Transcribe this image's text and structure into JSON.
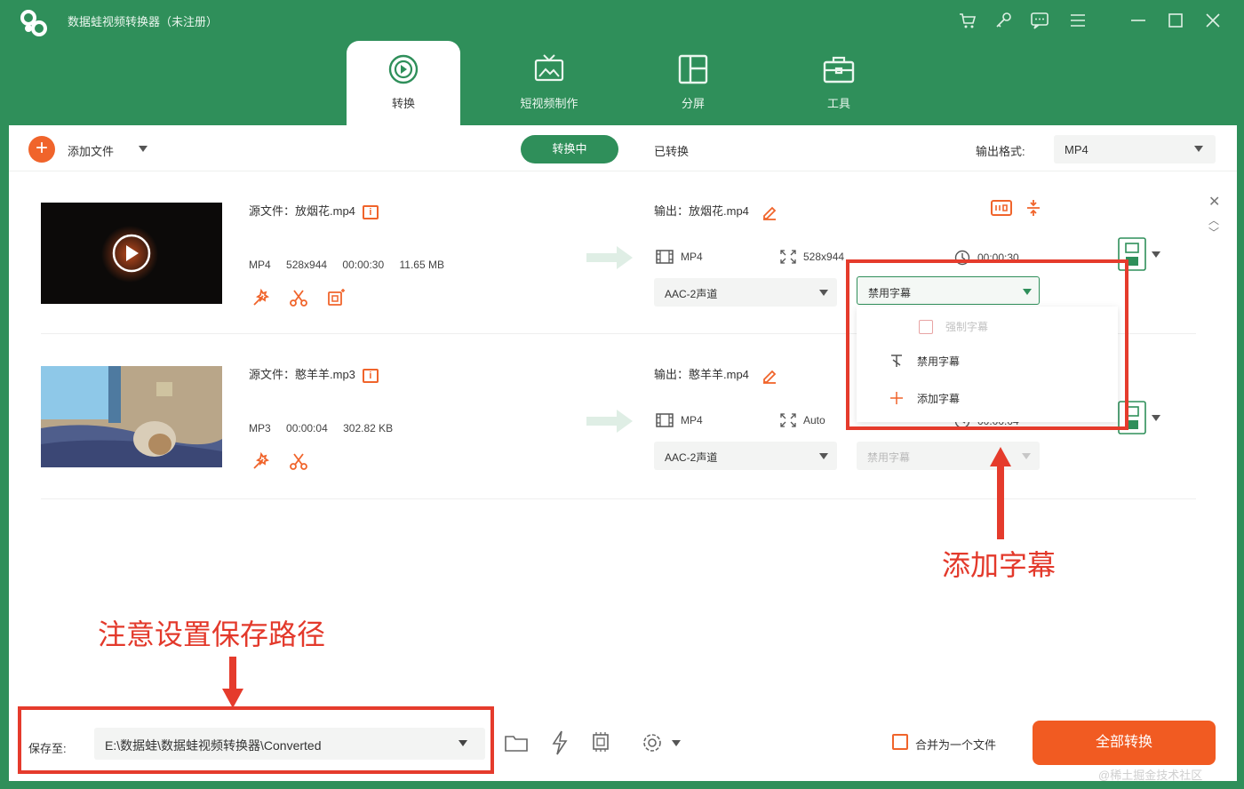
{
  "app": {
    "title": "数据蛙视频转换器（未注册）",
    "accent": "#2f8f5a",
    "action_color": "#f15b22"
  },
  "titlebar_icons": [
    "cart-icon",
    "key-icon",
    "chat-icon",
    "menu-icon",
    "minimize-icon",
    "maximize-icon",
    "close-icon"
  ],
  "tabs": [
    {
      "label": "转换",
      "icon": "convert-icon",
      "active": true
    },
    {
      "label": "短视频制作",
      "icon": "tv-icon",
      "active": false
    },
    {
      "label": "分屏",
      "icon": "split-screen-icon",
      "active": false
    },
    {
      "label": "工具",
      "icon": "toolbox-icon",
      "active": false
    }
  ],
  "toolbar": {
    "add_label": "添加文件",
    "converting": "转换中",
    "converted": "已转换",
    "output_format_label": "输出格式:",
    "output_format_value": "MP4"
  },
  "files": [
    {
      "source": "源文件：放烟花.mp4",
      "format": "MP4",
      "resolution": "528x944",
      "duration": "00:00:30",
      "size": "11.65 MB",
      "output": "输出：放烟花.mp4",
      "out_format": "MP4",
      "out_resolution": "528x944",
      "out_duration": "00:00:30",
      "audio": "AAC-2声道",
      "subtitle": "禁用字幕"
    },
    {
      "source": "源文件：憨羊羊.mp3",
      "format": "MP3",
      "duration": "00:00:04",
      "size": "302.82 KB",
      "output": "输出：憨羊羊.mp4",
      "out_format": "MP4",
      "out_resolution": "Auto",
      "out_duration": "00:00:04",
      "audio": "AAC-2声道",
      "subtitle": "禁用字幕"
    }
  ],
  "subtitle_menu": {
    "item_force": "强制字幕",
    "item_disable": "禁用字幕",
    "item_add": "添加字幕"
  },
  "annotations": {
    "add_subtitle": "添加字幕",
    "save_path_note": "注意设置保存路径"
  },
  "footer": {
    "save_to_label": "保存至:",
    "save_path": "E:\\数据蛙\\数据蛙视频转换器\\Converted",
    "merge_label": "合并为一个文件",
    "convert_all": "全部转换"
  },
  "watermark": "@稀土掘金技术社区"
}
